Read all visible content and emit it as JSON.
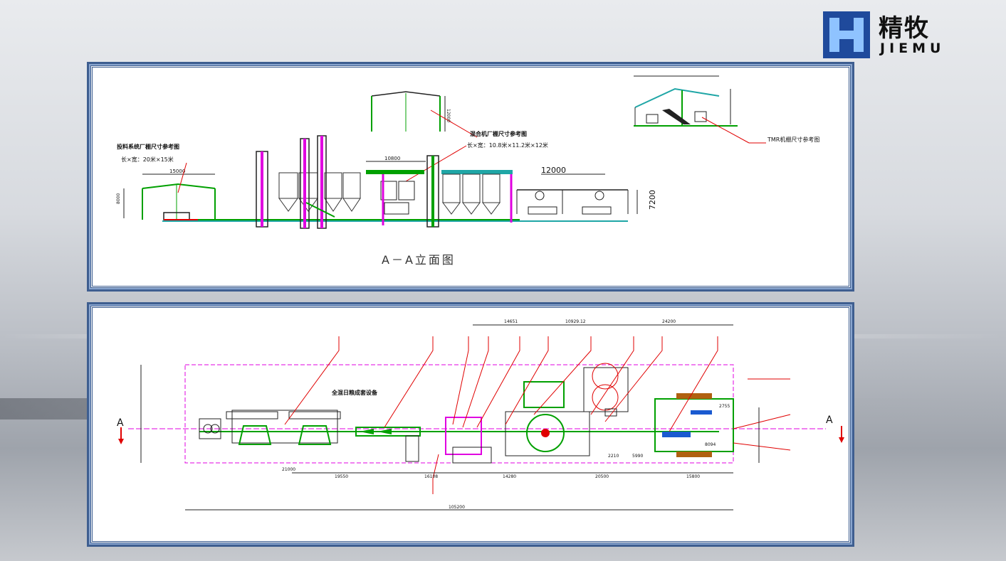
{
  "brand": {
    "name_cn": "精牧",
    "name_en": "JIEMU"
  },
  "elevation": {
    "caption": "A－A立面图",
    "feed_shed_label": "投料系统厂棚尺寸参考图",
    "feed_shed_size": "长×宽：20米×15米",
    "mixer_shed_label": "混合机厂棚尺寸参考图",
    "mixer_shed_size": "长×宽：10.8米×11.2米×12米",
    "tmr_label": "TMR机棚尺寸参考图",
    "dim_15000": "15000",
    "dim_8000": "8000",
    "dim_12000_top": "12000",
    "dim_10800": "10800",
    "dim_12000": "12000",
    "dim_7200": "7200"
  },
  "plan": {
    "title": "全混日粮成套设备",
    "section_left": "A",
    "section_right": "A",
    "dims_top": [
      "14651",
      "10929.12",
      "24200"
    ],
    "dims_bottom": [
      "21000",
      "19550",
      "16108",
      "14280",
      "20500",
      "15800"
    ],
    "dim_total": "105200",
    "dims_right": [
      "2755",
      "8094",
      "2210",
      "5990"
    ]
  },
  "colors": {
    "frame": "#3e5e90",
    "magenta": "#e000e0",
    "green": "#00a000",
    "red": "#e00000",
    "teal": "#1fa6a6",
    "dark": "#222222"
  }
}
